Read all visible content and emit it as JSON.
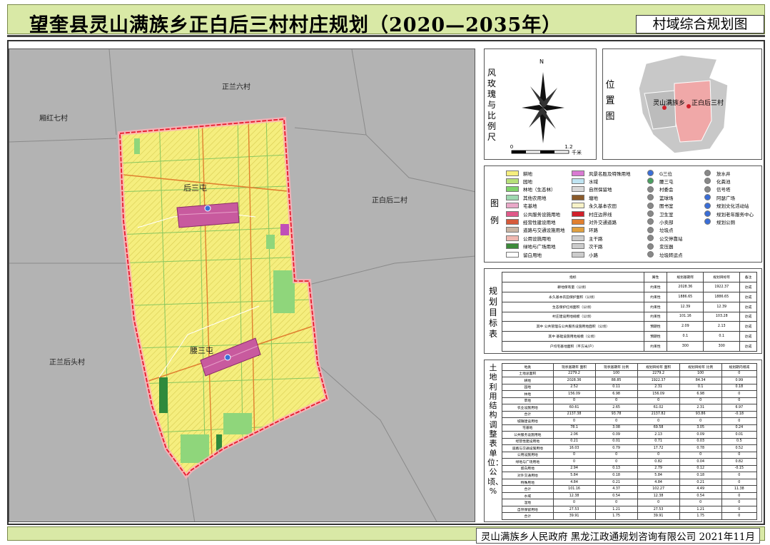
{
  "header": {
    "title": "望奎县灵山满族乡正白后三村村庄规划（2020—2035年）",
    "map_type": "村域综合规划图"
  },
  "map": {
    "neighbor_labels": [
      "正兰六村",
      "厢红七村",
      "正白后二村",
      "正兰后头村"
    ],
    "settlement_labels": [
      "后三屯",
      "腰三屯"
    ],
    "colors": {
      "farmland": "#f5ee7e",
      "settlement": "#c85a9e",
      "boundary": "#e8182d",
      "grassland": "#8fd67b",
      "forest": "#2f8a3c",
      "background": "#b3b3b3"
    }
  },
  "compass": {
    "label": "风玫瑰与比例尺",
    "north": "N",
    "scale_start": "0",
    "scale_end": "1.2",
    "scale_unit": "千米"
  },
  "location": {
    "label": "位置图",
    "township": "灵山满族乡",
    "village": "正白后三村"
  },
  "legend": {
    "label": "图例",
    "col1": [
      {
        "label": "耕地",
        "color": "#f5ee7e"
      },
      {
        "label": "园地",
        "color": "#b7e07a"
      },
      {
        "label": "林地（生态林）",
        "color": "#7fd36b"
      },
      {
        "label": "其他农用地",
        "color": "#9ed8b0"
      },
      {
        "label": "宅基地",
        "color": "#e9a8c8"
      },
      {
        "label": "公共服务设施用地",
        "color": "#e05a8a"
      },
      {
        "label": "经营性建设用地",
        "color": "#d65a3a"
      },
      {
        "label": "道路与交通设施用地",
        "color": "#c9b5a3"
      },
      {
        "label": "公用设施用地",
        "color": "#f0b8b0"
      },
      {
        "label": "绿地与广场用地",
        "color": "#3c8a3a"
      },
      {
        "label": "留白用地",
        "color": "#ffffff"
      }
    ],
    "col2": [
      {
        "label": "风景名胜及特殊用地",
        "color": "#d97ad2"
      },
      {
        "label": "水域",
        "color": "#bfe4f2"
      },
      {
        "label": "自然保留地",
        "color": "#d8d8d8"
      },
      {
        "label": "塘地",
        "color": "#8a5a2a"
      },
      {
        "label": "永久基本农田",
        "color": "#f7f2c8"
      },
      {
        "label": "村庄边界线",
        "color": "#d0202a"
      },
      {
        "label": "对外交通道路",
        "color": "#e08030"
      },
      {
        "label": "环路",
        "color": "#e0a040"
      },
      {
        "label": "主干路",
        "color": "#cccccc"
      },
      {
        "label": "次干路",
        "color": "#cccccc"
      },
      {
        "label": "小路",
        "color": "#cccccc"
      }
    ],
    "col3": [
      {
        "label": "G三位",
        "color": "#3a6ed8"
      },
      {
        "label": "腰三屯",
        "color": "#4aa060"
      },
      {
        "label": "村委会",
        "color": "#888888"
      },
      {
        "label": "篮球场",
        "color": "#888888"
      },
      {
        "label": "图书室",
        "color": "#888888"
      },
      {
        "label": "卫生室",
        "color": "#888888"
      },
      {
        "label": "小卖部",
        "color": "#888888"
      },
      {
        "label": "垃圾点",
        "color": "#888888"
      },
      {
        "label": "公交停靠站",
        "color": "#888888"
      },
      {
        "label": "变压器",
        "color": "#888888"
      },
      {
        "label": "垃圾转运点",
        "color": "#888888"
      }
    ],
    "col4": [
      {
        "label": "放水井",
        "color": "#888888"
      },
      {
        "label": "化粪池",
        "color": "#888888"
      },
      {
        "label": "信号塔",
        "color": "#888888"
      },
      {
        "label": "阿瑟广场",
        "color": "#3a6ed8"
      },
      {
        "label": "规划文化活动站",
        "color": "#3a6ed8"
      },
      {
        "label": "规划老年服务中心",
        "color": "#3a6ed8"
      },
      {
        "label": "规划公厕",
        "color": "#3a6ed8"
      }
    ]
  },
  "targets": {
    "label": "规划目标表",
    "headers": [
      "指标",
      "属性",
      "规划基期年",
      "规划目标年",
      "备注"
    ],
    "rows": [
      [
        "耕地保有量（公顷）",
        "约束性",
        "2028.36",
        "1922.37",
        "达成"
      ],
      [
        "永久基本农田保护面积（公顷）",
        "约束性",
        "1886.65",
        "1886.65",
        "达成"
      ],
      [
        "生态保护红线面积（公顷）",
        "约束性",
        "12.39",
        "12.39",
        "达成"
      ],
      [
        "村庄建设用地规模（公顷）",
        "约束性",
        "101.16",
        "103.28",
        "达成"
      ],
      [
        "其中 公共管理与公共服务设施用地面积（公顷）",
        "预期性",
        "2.09",
        "2.13",
        "达成"
      ],
      [
        "其中 基础设施用地规模（公顷）",
        "预期性",
        "0.1",
        "0.1",
        "达成"
      ],
      [
        "户均宅基地面积（平方米/户）",
        "约束性",
        "300",
        "300",
        "达成"
      ]
    ]
  },
  "landuse": {
    "label": "土地利用结构调整表 单位：公顷、%",
    "headers": [
      "地类",
      "现状基期年 面积",
      "现状基期年 比例",
      "规划目标年 面积",
      "规划目标年 比例",
      "规划期内增减"
    ],
    "rows": [
      [
        "土地总面积",
        "2279.2",
        "100",
        "2279.2",
        "100",
        "0"
      ],
      [
        "耕地",
        "2028.36",
        "88.85",
        "1922.37",
        "84.34",
        "0.99"
      ],
      [
        "园地",
        "2.52",
        "0.11",
        "2.31",
        "0.1",
        "0.18"
      ],
      [
        "林地",
        "156.09",
        "6.98",
        "156.09",
        "6.98",
        "0"
      ],
      [
        "草地",
        "0",
        "0",
        "0",
        "0",
        "0"
      ],
      [
        "农业设施用地",
        "60.61",
        "2.65",
        "61.02",
        "2.31",
        "6.97"
      ],
      [
        "合计",
        "2137.38",
        "93.78",
        "2137.82",
        "93.86",
        "-0.18"
      ],
      [
        "城镇建设用地",
        "0",
        "0",
        "0",
        "0",
        "0"
      ],
      [
        "宅基地",
        "78.1",
        "3.08",
        "69.58",
        "3.05",
        "0.24"
      ],
      [
        "公共服务设施用地",
        "2.06",
        "0.09",
        "2.13",
        "0.09",
        "0.01"
      ],
      [
        "经营性建设用地",
        "0.21",
        "0.01",
        "0.71",
        "0.03",
        "0.5"
      ],
      [
        "道路与交通设施用地",
        "16.03",
        "0.79",
        "17.72",
        "0.78",
        "0.52"
      ],
      [
        "公用设施用地",
        "0",
        "0",
        "0",
        "0",
        "0"
      ],
      [
        "绿地与广场用地",
        "0",
        "0",
        "0.82",
        "0.04",
        "0.82"
      ],
      [
        "留白用地",
        "2.94",
        "0.13",
        "2.79",
        "0.12",
        "-0.15"
      ],
      [
        "对外交通用地",
        "5.84",
        "0.18",
        "5.84",
        "0.18",
        "0"
      ],
      [
        "特殊用地",
        "4.84",
        "0.21",
        "4.84",
        "0.21",
        "0"
      ],
      [
        "合计",
        "101.16",
        "4.37",
        "102.27",
        "4.49",
        "11.38"
      ],
      [
        "水域",
        "12.38",
        "0.54",
        "12.38",
        "0.54",
        "0"
      ],
      [
        "湿地",
        "0",
        "0",
        "0",
        "0",
        "0"
      ],
      [
        "自然保留用地",
        "27.53",
        "1.21",
        "27.53",
        "1.21",
        "0"
      ],
      [
        "合计",
        "39.91",
        "1.75",
        "39.91",
        "1.75",
        "0"
      ]
    ]
  },
  "footer": {
    "text": "灵山满族乡人民政府  黑龙江政通规划咨询有限公司  2021年11月"
  }
}
